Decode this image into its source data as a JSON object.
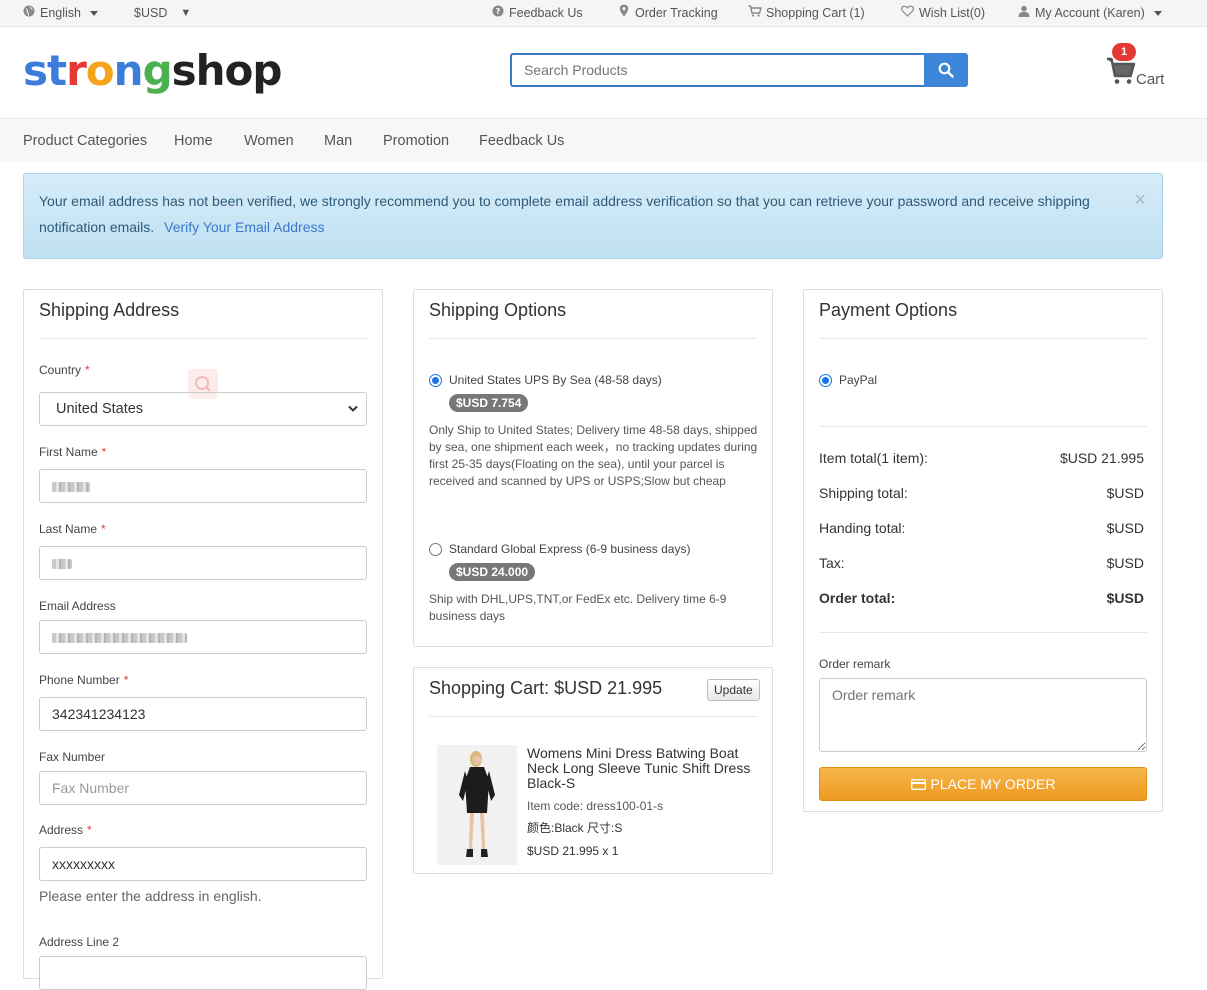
{
  "topbar": {
    "language": "English",
    "currency": "$USD",
    "feedback": "Feedback Us",
    "order_tracking": "Order Tracking",
    "shopping_cart": "Shopping Cart (1)",
    "wish_list": "Wish List(0)",
    "my_account": "My Account (Karen)"
  },
  "header": {
    "logo_letters": [
      "s",
      "t",
      "r",
      "o",
      "n",
      "g",
      "s",
      "h",
      "o",
      "p"
    ],
    "logo_colors": [
      "#3c7ddb",
      "#3c7ddb",
      "#e53935",
      "#f4a51c",
      "#3c7ddb",
      "#4caf50",
      "#222222",
      "#222222",
      "#222222",
      "#222222"
    ],
    "search_placeholder": "Search Products",
    "cart_count": "1",
    "cart_label": "Cart"
  },
  "nav": {
    "items": [
      "Product Categories",
      "Home",
      "Women",
      "Man",
      "Promotion",
      "Feedback Us"
    ]
  },
  "alert": {
    "message": "Your email address has not been verified, we strongly recommend you to complete email address verification so that you can retrieve your password and receive shipping notification emails.",
    "link": "Verify Your Email Address",
    "close": "×"
  },
  "shipping_address": {
    "title": "Shipping Address",
    "country_label": "Country",
    "country_value": "United States",
    "first_name_label": "First Name",
    "last_name_label": "Last Name",
    "email_label": "Email Address",
    "phone_label": "Phone Number",
    "phone_value": "342341234123",
    "fax_label": "Fax Number",
    "fax_placeholder": "Fax Number",
    "address_label": "Address",
    "address_value": "xxxxxxxxx",
    "address_hint": "Please enter the address in english.",
    "address2_label": "Address Line 2",
    "required_mark": "*"
  },
  "shipping_options": {
    "title": "Shipping Options",
    "options": [
      {
        "label": "United States UPS By Sea (48-58 days)",
        "price": "$USD 7.754",
        "selected": true,
        "description": "Only Ship to United States; Delivery time 48-58 days, shipped by sea, one shipment each week，no tracking updates during first 25-35 days(Floating on the sea), until your parcel is received and scanned by UPS or USPS;Slow but cheap"
      },
      {
        "label": "Standard Global Express (6-9 business days)",
        "price": "$USD 24.000",
        "selected": false,
        "description": "Ship with DHL,UPS,TNT,or FedEx etc. Delivery time 6-9 business days"
      }
    ]
  },
  "cart_panel": {
    "title": "Shopping Cart: $USD 21.995",
    "update_label": "Update",
    "product_name": "Womens Mini Dress Batwing Boat Neck Long Sleeve Tunic Shift Dress Black-S",
    "item_code": "Item code: dress100-01-s",
    "variant": "颜色:Black 尺寸:S",
    "price_qty": "$USD 21.995 x 1"
  },
  "payment": {
    "title": "Payment Options",
    "method": "PayPal",
    "rows": [
      {
        "label": "Item total(1 item):",
        "value": "$USD 21.995"
      },
      {
        "label": "Shipping total:",
        "value": "$USD"
      },
      {
        "label": "Handing total:",
        "value": "$USD"
      },
      {
        "label": "Tax:",
        "value": "$USD"
      },
      {
        "label": "Order total:",
        "value": "$USD"
      }
    ],
    "remark_label": "Order remark",
    "remark_placeholder": "Order remark",
    "place_order": "PLACE MY ORDER"
  }
}
